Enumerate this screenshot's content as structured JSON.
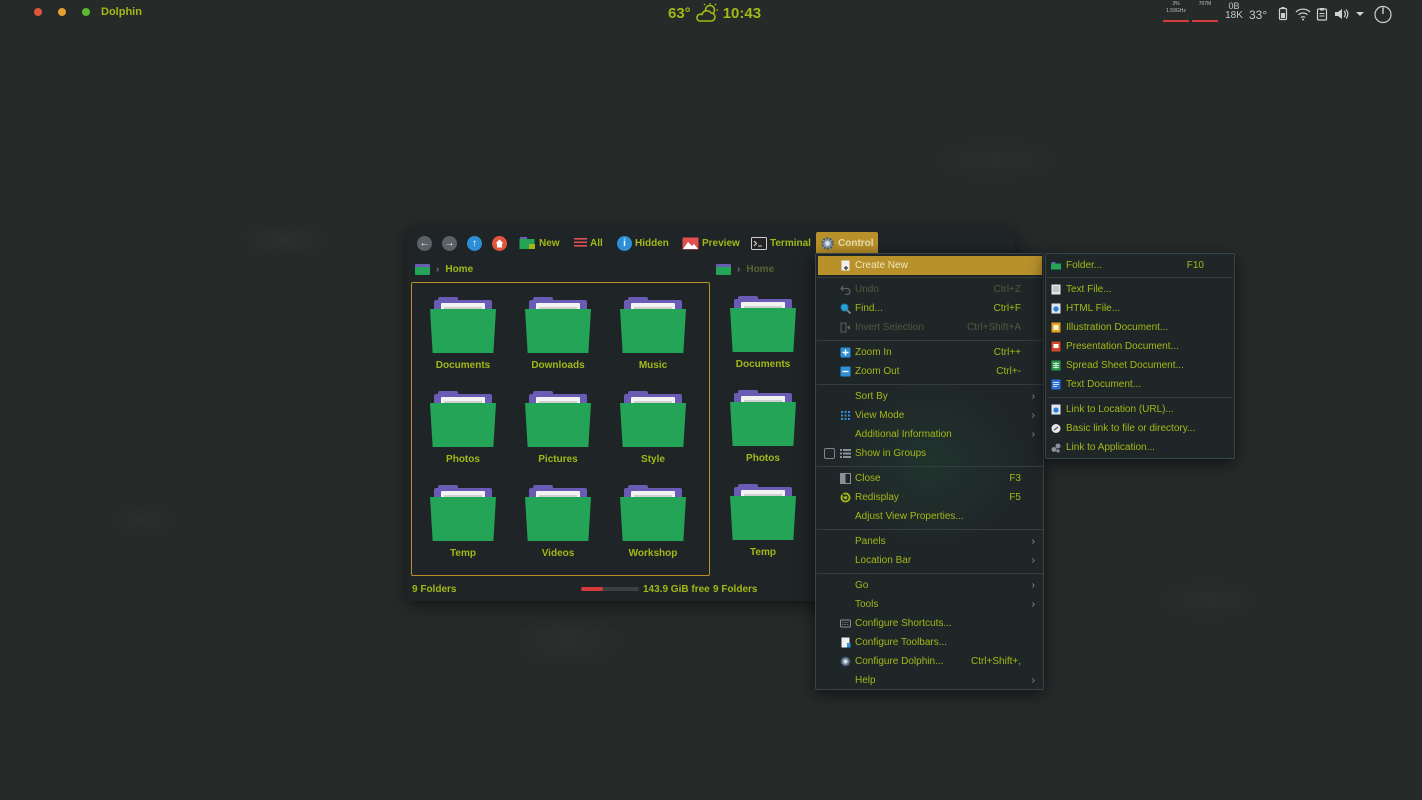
{
  "panel": {
    "app_name": "Dolphin",
    "weather_temp": "63°",
    "clock": "10:43",
    "cpu_percent": "3%",
    "cpu_freq": "1.59GHz",
    "memory": "707M",
    "net_up": "0B",
    "net_down": "18K",
    "cpu_temp": "33°"
  },
  "toolbar": {
    "new_label": "New",
    "all_label": "All",
    "hidden_label": "Hidden",
    "preview_label": "Preview",
    "terminal_label": "Terminal",
    "control_label": "Control"
  },
  "left_pane": {
    "breadcrumb": "Home",
    "folders": [
      "Documents",
      "Downloads",
      "Music",
      "Photos",
      "Pictures",
      "Style",
      "Temp",
      "Videos",
      "Workshop"
    ],
    "status": "9 Folders",
    "free_space": "143.9 GiB free",
    "used_fraction": 0.38
  },
  "right_pane": {
    "breadcrumb": "Home",
    "folders": [
      "Documents",
      "Photos",
      "Temp"
    ],
    "status": "9 Folders"
  },
  "menu": {
    "create_new": "Create New",
    "undo": "Undo",
    "undo_sc": "Ctrl+Z",
    "find": "Find...",
    "find_sc": "Ctrl+F",
    "invert": "Invert Selection",
    "invert_sc": "Ctrl+Shift+A",
    "zoom_in": "Zoom In",
    "zoom_in_sc": "Ctrl++",
    "zoom_out": "Zoom Out",
    "zoom_out_sc": "Ctrl+-",
    "sort_by": "Sort By",
    "view_mode": "View Mode",
    "additional_info": "Additional Information",
    "show_groups": "Show in Groups",
    "close": "Close",
    "close_sc": "F3",
    "redisplay": "Redisplay",
    "redisplay_sc": "F5",
    "adjust_view": "Adjust View Properties...",
    "panels": "Panels",
    "location_bar": "Location Bar",
    "go": "Go",
    "tools": "Tools",
    "config_shortcuts": "Configure Shortcuts...",
    "config_toolbars": "Configure Toolbars...",
    "config_dolphin": "Configure Dolphin...",
    "config_dolphin_sc": "Ctrl+Shift+,",
    "help": "Help"
  },
  "submenu": {
    "folder": "Folder...",
    "folder_sc": "F10",
    "text_file": "Text File...",
    "html_file": "HTML File...",
    "illustration": "Illustration Document...",
    "presentation": "Presentation Document...",
    "spreadsheet": "Spread Sheet Document...",
    "text_doc": "Text Document...",
    "link_url": "Link to Location (URL)...",
    "basic_link": "Basic link to file or directory...",
    "link_app": "Link to Application..."
  }
}
